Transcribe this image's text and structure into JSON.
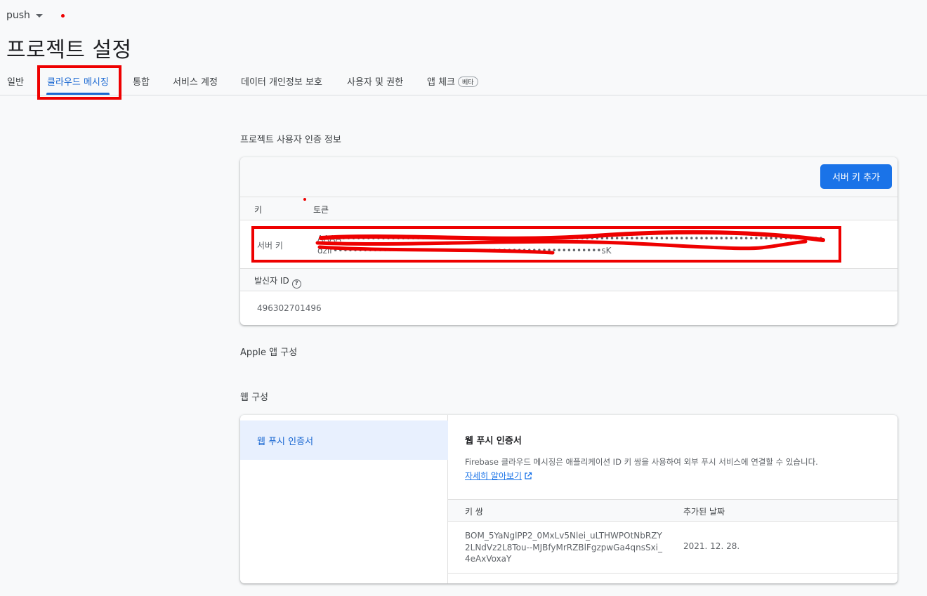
{
  "topbar": {
    "project_name": "push"
  },
  "page": {
    "title": "프로젝트 설정"
  },
  "tabs": [
    {
      "label": "일반"
    },
    {
      "label": "클라우드 메시징"
    },
    {
      "label": "통합"
    },
    {
      "label": "서비스 계정"
    },
    {
      "label": "데이터 개인정보 보호"
    },
    {
      "label": "사용자 및 권한"
    },
    {
      "label": "앱 체크",
      "badge": "베타"
    }
  ],
  "credentials": {
    "section_title": "프로젝트 사용자 인증 정보",
    "add_button": "서버 키 추가",
    "col_key": "키",
    "col_token": "토큰",
    "server_key_label": "서버 키",
    "server_key_line1": "AAAA••••••••••••••••••••••••••••••••••••••••••••••••••••••••••••••••••••••••••••••••••••••••••••••••••••••••••••••••••••",
    "server_key_line2": "dzlr••••••••••••••••••••••••••••••••••••••••••••••••••••••sK",
    "sender_label": "발신자 ID",
    "sender_help": "?",
    "sender_id": "496302701496"
  },
  "apple": {
    "section_title": "Apple 앱 구성"
  },
  "web": {
    "section_title": "웹 구성",
    "nav_item": "웹 푸시 인증서",
    "detail_title": "웹 푸시 인증서",
    "description": "Firebase 클라우드 메시징은 애플리케이션 ID 키 쌍을 사용하여 외부 푸시 서비스에 연결할 수 있습니다.",
    "learn_more": "자세히 알아보기",
    "col_keypair": "키 쌍",
    "col_date": "추가된 날짜",
    "keypair_line1": "BOM_5YaNglPP2_0MxLv5Nlei_uLTHWPOtNbRZY",
    "keypair_line2": "2LNdVz2L8Tou--MJBfyMrRZBlFgzpwGa4qnsSxi_",
    "keypair_line3": "4eAxVoxaY",
    "date": "2021. 12. 28."
  },
  "colors": {
    "accent": "#1a73e8",
    "annotation": "#ee0000"
  }
}
